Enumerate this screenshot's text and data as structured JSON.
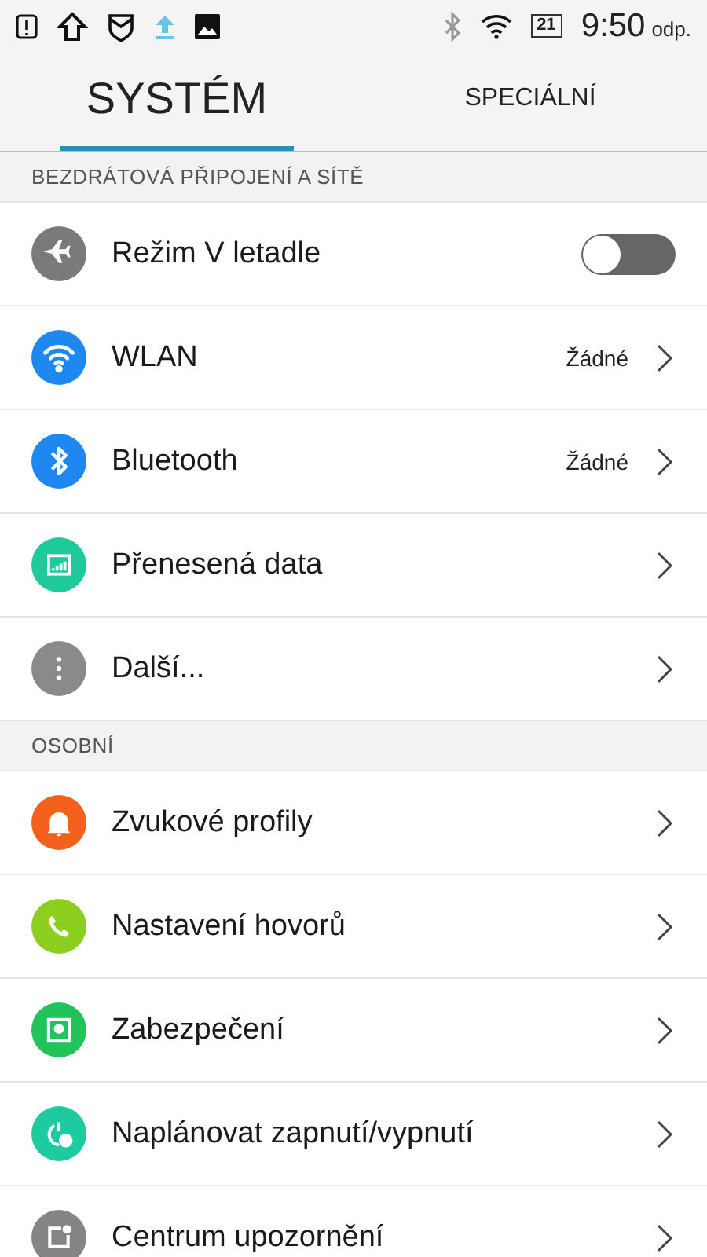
{
  "status_bar": {
    "battery": "21",
    "time": "9:50",
    "period": "odp."
  },
  "tabs": [
    {
      "label": "SYSTÉM",
      "selected": true
    },
    {
      "label": "SPECIÁLNÍ",
      "selected": false
    }
  ],
  "sections": [
    {
      "title": "BEZDRÁTOVÁ PŘIPOJENÍ A SÍTĚ",
      "items": [
        {
          "kind": "toggle",
          "label": "Režim V letadle",
          "color": "#7a7a7a",
          "on": false
        },
        {
          "kind": "link",
          "label": "WLAN",
          "color": "#1e88f0",
          "value": "Žádné"
        },
        {
          "kind": "link",
          "label": "Bluetooth",
          "color": "#1e88f0",
          "value": "Žádné"
        },
        {
          "kind": "link",
          "label": "Přenesená data",
          "color": "#1ec99a"
        },
        {
          "kind": "link",
          "label": "Další...",
          "color": "#8a8a8a"
        }
      ]
    },
    {
      "title": "OSOBNÍ",
      "items": [
        {
          "kind": "link",
          "label": "Zvukové profily",
          "color": "#f4611c"
        },
        {
          "kind": "link",
          "label": "Nastavení hovorů",
          "color": "#8ccf1e"
        },
        {
          "kind": "link",
          "label": "Zabezpečení",
          "color": "#22c35a"
        },
        {
          "kind": "link",
          "label": "Naplánovat zapnutí/vypnutí",
          "color": "#1ecba0"
        },
        {
          "kind": "link",
          "label": "Centrum upozornění",
          "color": "#858585"
        }
      ]
    }
  ]
}
